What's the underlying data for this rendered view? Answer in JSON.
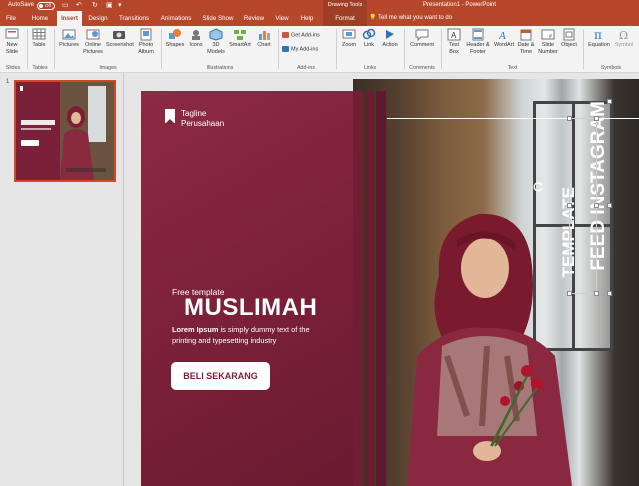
{
  "titlebar": {
    "autosave_label": "AutoSave",
    "autosave_state": "Off",
    "title": "Presentation1 - PowerPoint",
    "drawing_tools": "Drawing Tools"
  },
  "tabs": [
    {
      "label": "File"
    },
    {
      "label": "Home"
    },
    {
      "label": "Insert"
    },
    {
      "label": "Design"
    },
    {
      "label": "Transitions"
    },
    {
      "label": "Animations"
    },
    {
      "label": "Slide Show"
    },
    {
      "label": "Review"
    },
    {
      "label": "View"
    },
    {
      "label": "Help"
    },
    {
      "label": "Format"
    }
  ],
  "tell_me": "Tell me what you want to do",
  "ribbon": {
    "new_slide": "New Slide",
    "table": "Table",
    "pictures": "Pictures",
    "online_pictures": "Online Pictures",
    "screenshot": "Screenshot",
    "photo_album": "Photo Album",
    "shapes": "Shapes",
    "icons": "Icons",
    "models_3d": "3D Models",
    "smartart": "SmartArt",
    "chart": "Chart",
    "get_addins": "Get Add-ins",
    "my_addins": "My Add-ins",
    "zoom": "Zoom",
    "link": "Link",
    "action": "Action",
    "comment": "Comment",
    "text_box": "Text Box",
    "header_footer": "Header & Footer",
    "wordart": "WordArt",
    "date_time": "Date & Time",
    "slide_number": "Slide Number",
    "object": "Object",
    "equation": "Equation",
    "symbol": "Symbol",
    "groups": {
      "slides": "Slides",
      "tables": "Tables",
      "images": "Images",
      "illustrations": "Illustrations",
      "addins": "Add-ins",
      "links": "Links",
      "comments": "Comments",
      "text": "Text",
      "symbols": "Symbols"
    }
  },
  "thumbnails": [
    {
      "number": "1"
    }
  ],
  "slide": {
    "tagline_line1": "Tagline",
    "tagline_line2": "Perusahaan",
    "free_template": "Free template",
    "headline": "MUSLIMAH",
    "lorem_bold": "Lorem Ipsum",
    "lorem_rest_1": " is simply dummy text of the",
    "lorem_line2": "printing and typesetting industry",
    "button": "BELI SEKARANG",
    "vertical_1": "TEMPLATE",
    "vertical_2": "FEED INSTAGRAM"
  },
  "colors": {
    "accent": "#b7472a",
    "maroon": "#7a2038",
    "ribbon_bg": "#f3f3f3"
  }
}
